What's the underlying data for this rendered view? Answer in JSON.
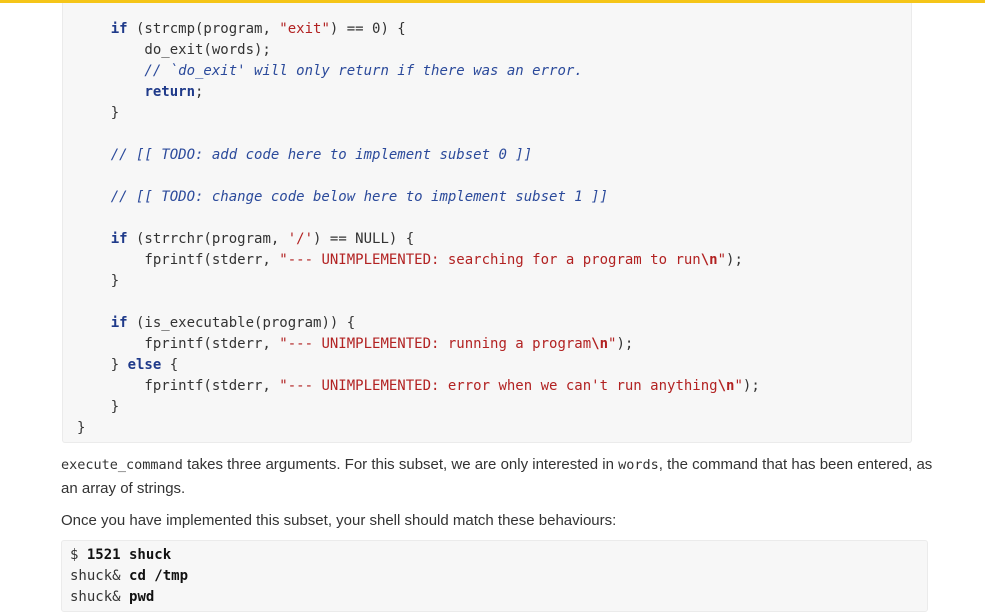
{
  "code": {
    "l1": {
      "kw_if": "if",
      "text": " (strcmp(program, ",
      "str": "\"exit\"",
      "rest": ") == 0) {"
    },
    "l2": {
      "text": "    do_exit(words);"
    },
    "l3": {
      "comment": "    // `do_exit' will only return if there was an error."
    },
    "l4": {
      "indent": "    ",
      "kw_return": "return",
      "rest": ";"
    },
    "l5": {
      "text": "}"
    },
    "l7": {
      "comment": "// [[ TODO: add code here to implement subset 0 ]]"
    },
    "l9": {
      "comment": "// [[ TODO: change code below here to implement subset 1 ]]"
    },
    "l11": {
      "kw_if": "if",
      "text": " (strrchr(program, ",
      "str": "'/'",
      "rest": ") == NULL) {"
    },
    "l12": {
      "text": "    fprintf(stderr, ",
      "str": "\"--- UNIMPLEMENTED: searching for a program to run",
      "esc": "\\n",
      "str_end": "\"",
      "rest": ");"
    },
    "l13": {
      "text": "}"
    },
    "l15": {
      "kw_if": "if",
      "text": " (is_executable(program)) {"
    },
    "l16": {
      "text": "    fprintf(stderr, ",
      "str": "\"--- UNIMPLEMENTED: running a program",
      "esc": "\\n",
      "str_end": "\"",
      "rest": ");"
    },
    "l17": {
      "brace": "} ",
      "kw_else": "else",
      "rest": " {"
    },
    "l18": {
      "text": "    fprintf(stderr, ",
      "str": "\"--- UNIMPLEMENTED: error when we can't run anything",
      "esc": "\\n",
      "str_end": "\"",
      "rest": ");"
    },
    "l19": {
      "text": "}"
    },
    "l20": {
      "text": "}"
    }
  },
  "para1": {
    "code_execute": "execute_command",
    "text_a": " takes three arguments. For this subset, we are only interested in ",
    "code_words": "words",
    "text_b": ", the command that has been entered, as an array of strings."
  },
  "para2": {
    "text": "Once you have implemented this subset, your shell should match these behaviours:"
  },
  "terminal": {
    "l1": {
      "prompt": "$ ",
      "cmd": "1521 shuck"
    },
    "l2": {
      "prompt": "shuck& ",
      "cmd": "cd /tmp"
    },
    "l3": {
      "prompt": "shuck& ",
      "cmd": "pwd"
    }
  },
  "colors": {
    "accent": "#f5c518",
    "keyword": "#1f3a8a",
    "string": "#b22222",
    "comment": "#2b4a9b",
    "code_bg": "#f7f7f7"
  }
}
